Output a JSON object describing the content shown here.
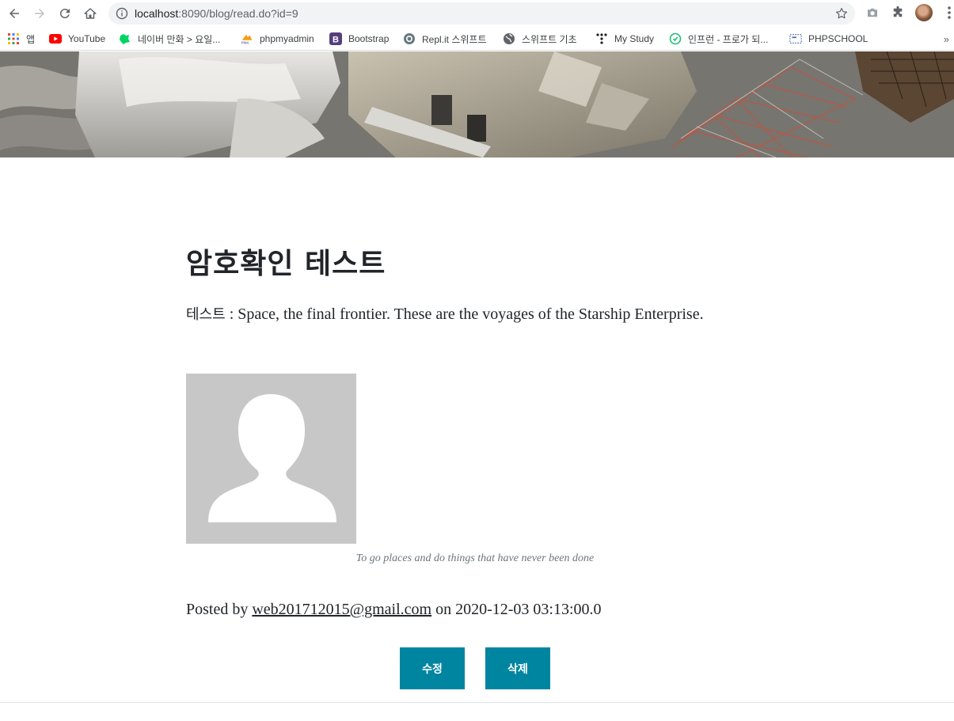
{
  "browser": {
    "url_host": "localhost",
    "url_rest": ":8090/blog/read.do?id=9",
    "bookmarks": [
      {
        "label": "앱",
        "icon": "apps-grid-icon"
      },
      {
        "label": "YouTube",
        "icon": "youtube-icon"
      },
      {
        "label": "네이버 만화 > 요일...",
        "icon": "naver-webtoon-icon"
      },
      {
        "label": "phpmyadmin",
        "icon": "phpmyadmin-icon"
      },
      {
        "label": "Bootstrap",
        "icon": "bootstrap-icon"
      },
      {
        "label": "Repl.it 스위프트",
        "icon": "replit-icon"
      },
      {
        "label": "스위프트 기초",
        "icon": "globe-icon"
      },
      {
        "label": "My Study",
        "icon": "dots-icon"
      },
      {
        "label": "인프런 - 프로가 되...",
        "icon": "inflearn-icon"
      },
      {
        "label": "PHPSCHOOL",
        "icon": "phpschool-icon"
      }
    ],
    "more": "»"
  },
  "post": {
    "title": "암호확인 테스트",
    "body_ko": "테스트",
    "body_en": " : Space, the final frontier. These are the voyages of the Starship Enterprise.",
    "caption": "To go places and do things that have never been done",
    "posted_by_prefix": "Posted by ",
    "author": "web201712015@gmail.com",
    "posted_on_prefix": " on ",
    "date": "2020-12-03 03:13:00.0"
  },
  "actions": {
    "edit_label": "수정",
    "delete_label": "삭제"
  },
  "colors": {
    "button": "#0085a1",
    "profile_bg": "#c8c7c8"
  }
}
